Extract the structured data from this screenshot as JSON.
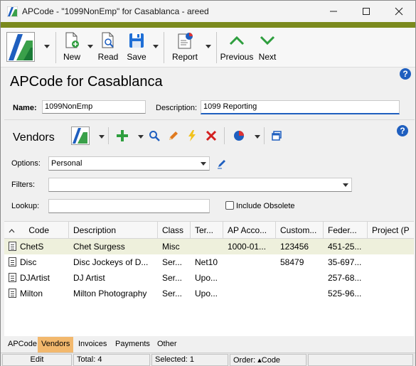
{
  "window": {
    "title": "APCode - \"1099NonEmp\" for Casablanca - areed"
  },
  "toolbar": {
    "new_label": "New",
    "read_label": "Read",
    "save_label": "Save",
    "report_label": "Report",
    "previous_label": "Previous",
    "next_label": "Next"
  },
  "header": {
    "title": "APCode for Casablanca"
  },
  "form": {
    "name_label": "Name:",
    "name_value": "1099NonEmp",
    "description_label": "Description:",
    "description_value": "1099 Reporting"
  },
  "vendors": {
    "title": "Vendors",
    "options_label": "Options:",
    "options_value": "Personal",
    "filters_label": "Filters:",
    "filters_value": "",
    "lookup_label": "Lookup:",
    "lookup_value": "",
    "include_obsolete_label": "Include Obsolete",
    "include_obsolete_checked": false
  },
  "grid": {
    "columns": [
      "Code",
      "Description",
      "Class",
      "Ter...",
      "AP Acco...",
      "Custom...",
      "Feder...",
      "Project (P"
    ],
    "rows": [
      {
        "code": "ChetS",
        "description": "Chet Surgess",
        "class": "Misc",
        "terms": "",
        "ap_account": "1000-01...",
        "customer": "123456",
        "federal": "451-25...",
        "project": "",
        "selected": true
      },
      {
        "code": "Disc",
        "description": "Disc Jockeys of D...",
        "class": "Ser...",
        "terms": "Net10",
        "ap_account": "",
        "customer": "58479",
        "federal": "35-697...",
        "project": "",
        "selected": false
      },
      {
        "code": "DJArtist",
        "description": "DJ Artist",
        "class": "Ser...",
        "terms": "Upo...",
        "ap_account": "",
        "customer": "",
        "federal": "257-68...",
        "project": "",
        "selected": false
      },
      {
        "code": "Milton",
        "description": "Milton Photography",
        "class": "Ser...",
        "terms": "Upo...",
        "ap_account": "",
        "customer": "",
        "federal": "525-96...",
        "project": "",
        "selected": false
      }
    ]
  },
  "tabs": [
    "APCode",
    "Vendors",
    "Invoices",
    "Payments",
    "Other"
  ],
  "active_tab": "Vendors",
  "status": {
    "mode": "Edit",
    "total": "Total: 4",
    "selected": "Selected: 1",
    "order": "Order: ▴Code"
  },
  "colors": {
    "accent": "#7b8a1e",
    "active_tab": "#f2b86d",
    "selected_row": "#eef0dc",
    "help": "#1f5fbf"
  }
}
